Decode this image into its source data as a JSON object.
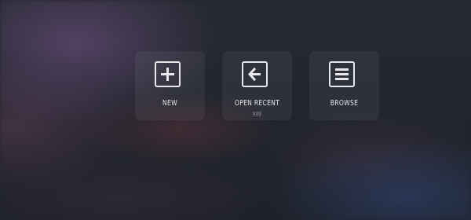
{
  "actions": {
    "new": {
      "label": "NEW",
      "icon": "plus-icon"
    },
    "open_recent": {
      "label": "OPEN RECENT",
      "sublabel": "ggg",
      "icon": "arrow-left-icon"
    },
    "browse": {
      "label": "BROWSE",
      "icon": "menu-lines-icon"
    }
  },
  "colors": {
    "icon": "#e8e8ec",
    "label": "#e4e4e8",
    "sublabel": "#a0a2aa",
    "tile_background": "rgba(255,255,255,0.055)"
  }
}
